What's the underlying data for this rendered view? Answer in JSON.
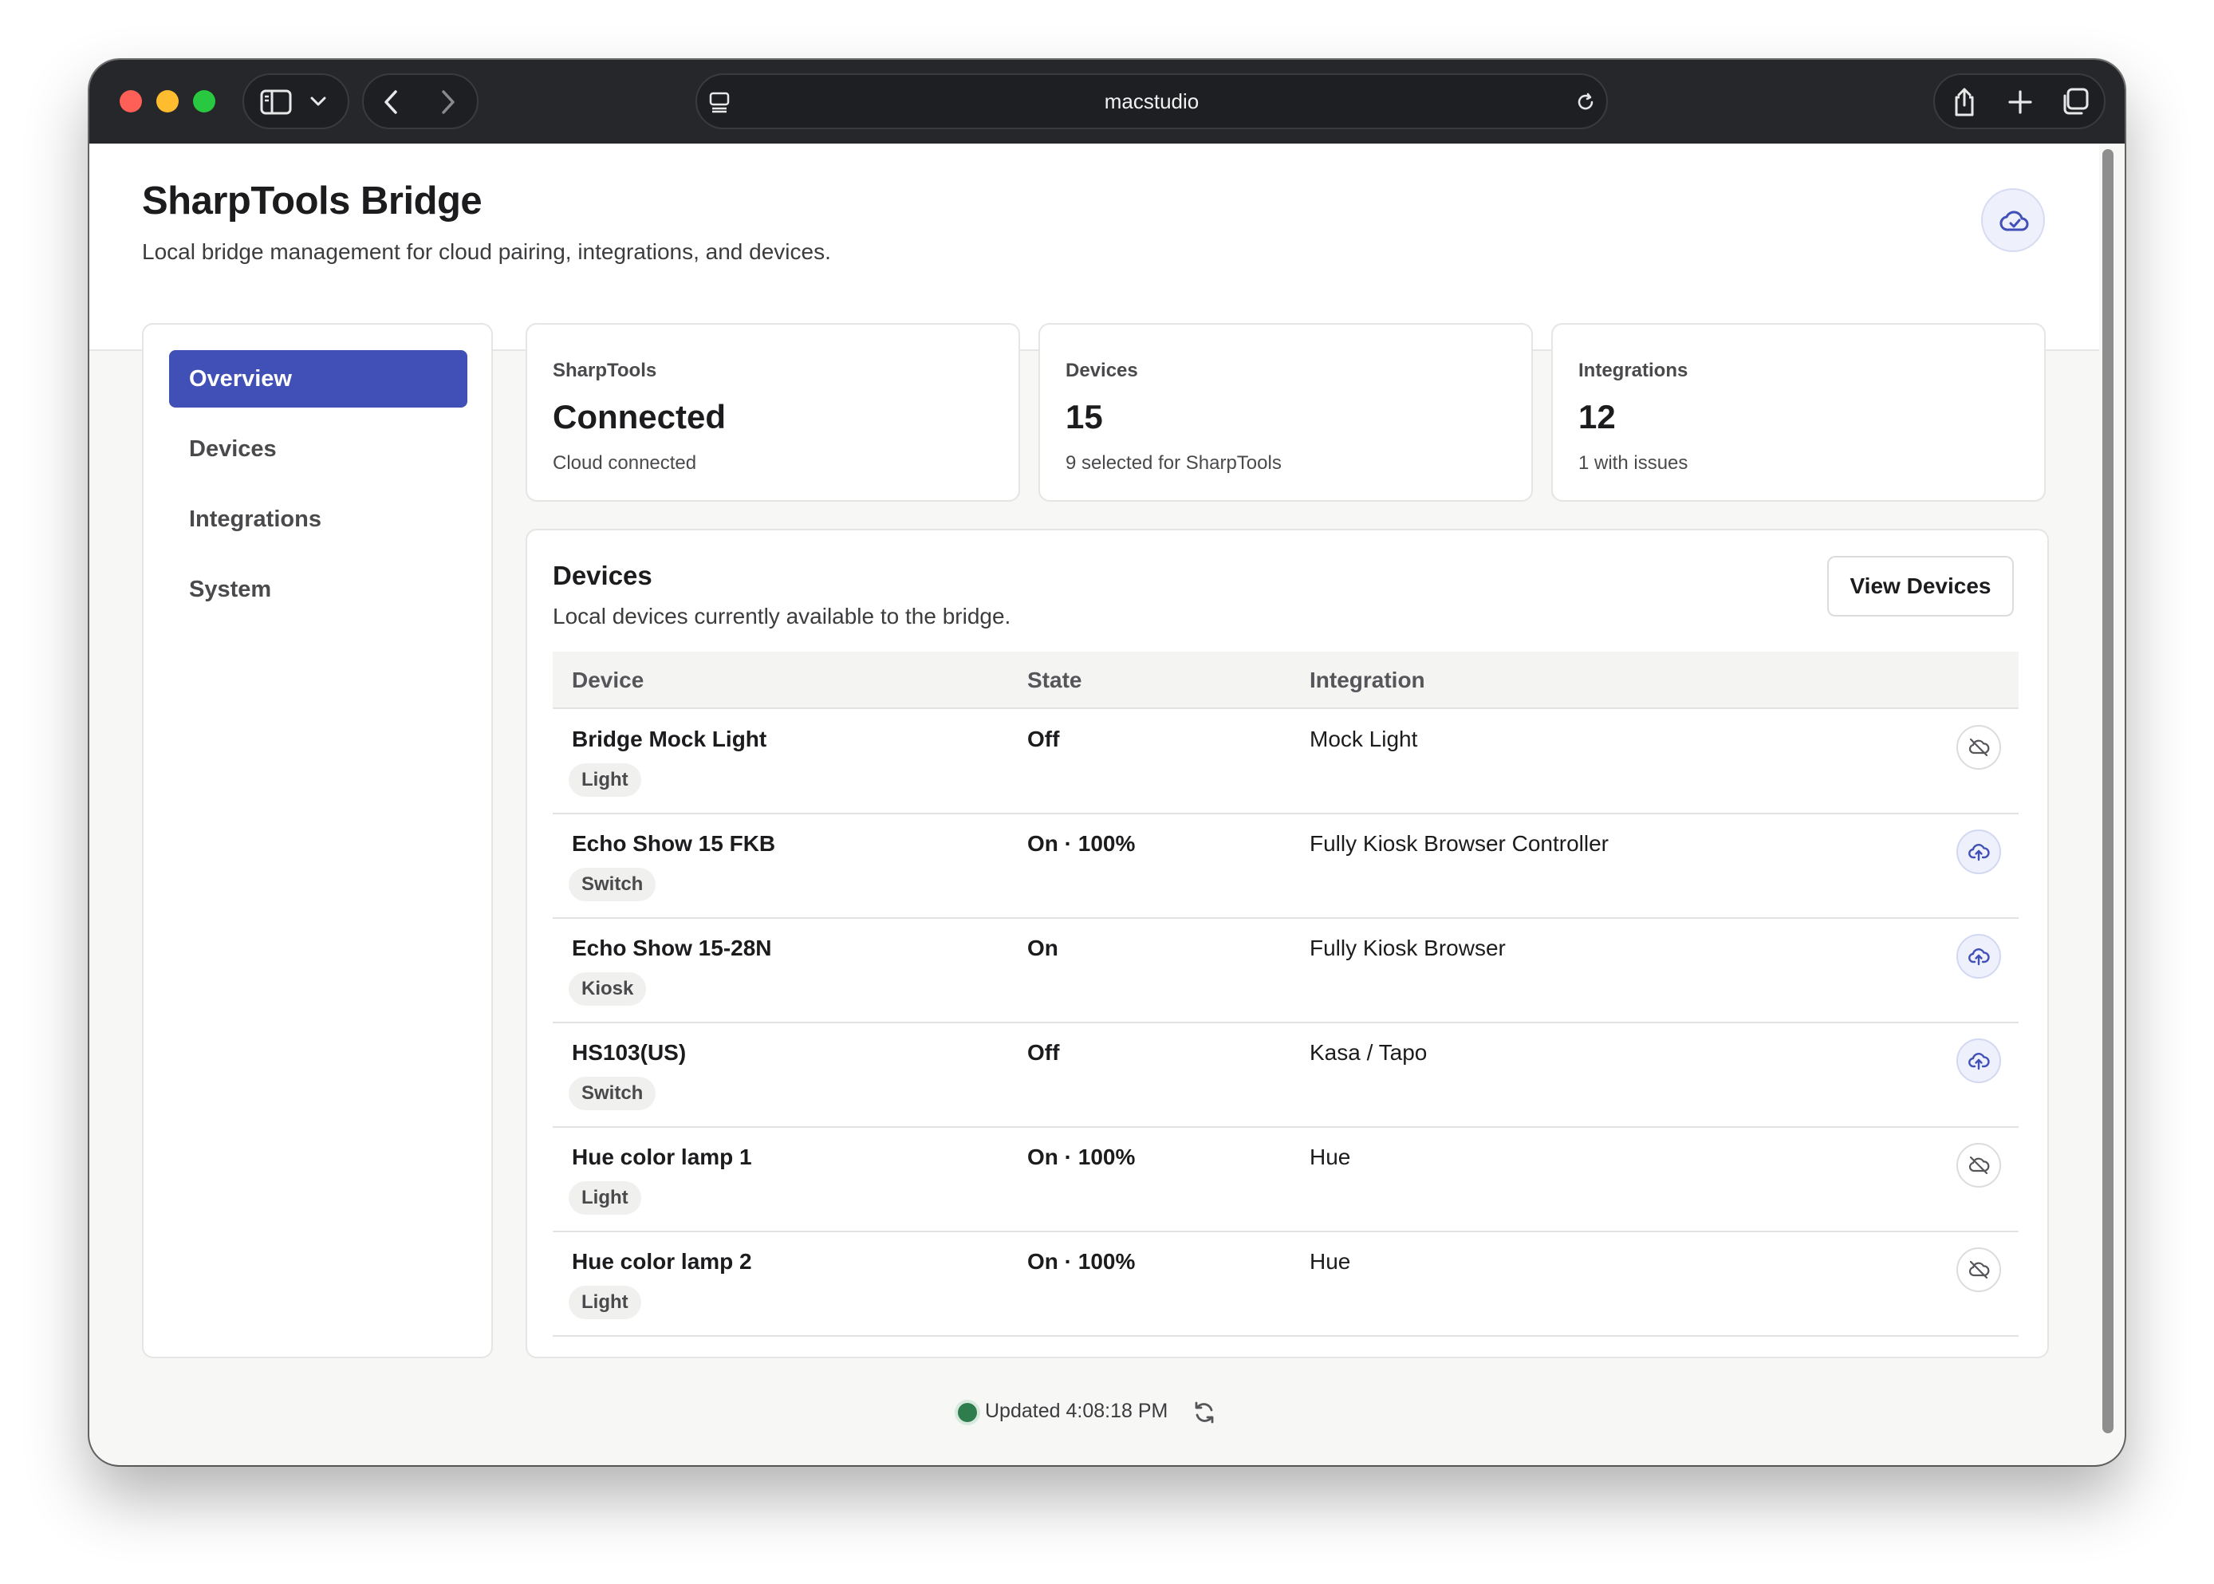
{
  "browser": {
    "address": "macstudio"
  },
  "header": {
    "title": "SharpTools Bridge",
    "subtitle": "Local bridge management for cloud pairing, integrations, and devices."
  },
  "sidebar": {
    "items": [
      {
        "label": "Overview",
        "active": true
      },
      {
        "label": "Devices",
        "active": false
      },
      {
        "label": "Integrations",
        "active": false
      },
      {
        "label": "System",
        "active": false
      }
    ]
  },
  "stats": [
    {
      "label": "SharpTools",
      "value": "Connected",
      "sub": "Cloud connected"
    },
    {
      "label": "Devices",
      "value": "15",
      "sub": "9 selected for SharpTools"
    },
    {
      "label": "Integrations",
      "value": "12",
      "sub": "1 with issues"
    }
  ],
  "devices_panel": {
    "title": "Devices",
    "subtitle": "Local devices currently available to the bridge.",
    "view_button": "View Devices",
    "columns": [
      "Device",
      "State",
      "Integration"
    ],
    "rows": [
      {
        "name": "Bridge Mock Light",
        "type": "Light",
        "state": "Off",
        "integration": "Mock Light",
        "action_icon": "cloud-off-icon"
      },
      {
        "name": "Echo Show 15 FKB",
        "type": "Switch",
        "state": "On · 100%",
        "integration": "Fully Kiosk Browser Controller",
        "action_icon": "cloud-upload-icon"
      },
      {
        "name": "Echo Show 15-28N",
        "type": "Kiosk",
        "state": "On",
        "integration": "Fully Kiosk Browser",
        "action_icon": "cloud-upload-icon"
      },
      {
        "name": "HS103(US)",
        "type": "Switch",
        "state": "Off",
        "integration": "Kasa / Tapo",
        "action_icon": "cloud-upload-icon"
      },
      {
        "name": "Hue color lamp 1",
        "type": "Light",
        "state": "On · 100%",
        "integration": "Hue",
        "action_icon": "cloud-off-icon"
      },
      {
        "name": "Hue color lamp 2",
        "type": "Light",
        "state": "On · 100%",
        "integration": "Hue",
        "action_icon": "cloud-off-icon"
      }
    ]
  },
  "footer": {
    "updated": "Updated 4:08:18 PM"
  },
  "colors": {
    "accent": "#4150b6",
    "status_ok": "#2f7d4c",
    "titlebar": "#26272a"
  }
}
